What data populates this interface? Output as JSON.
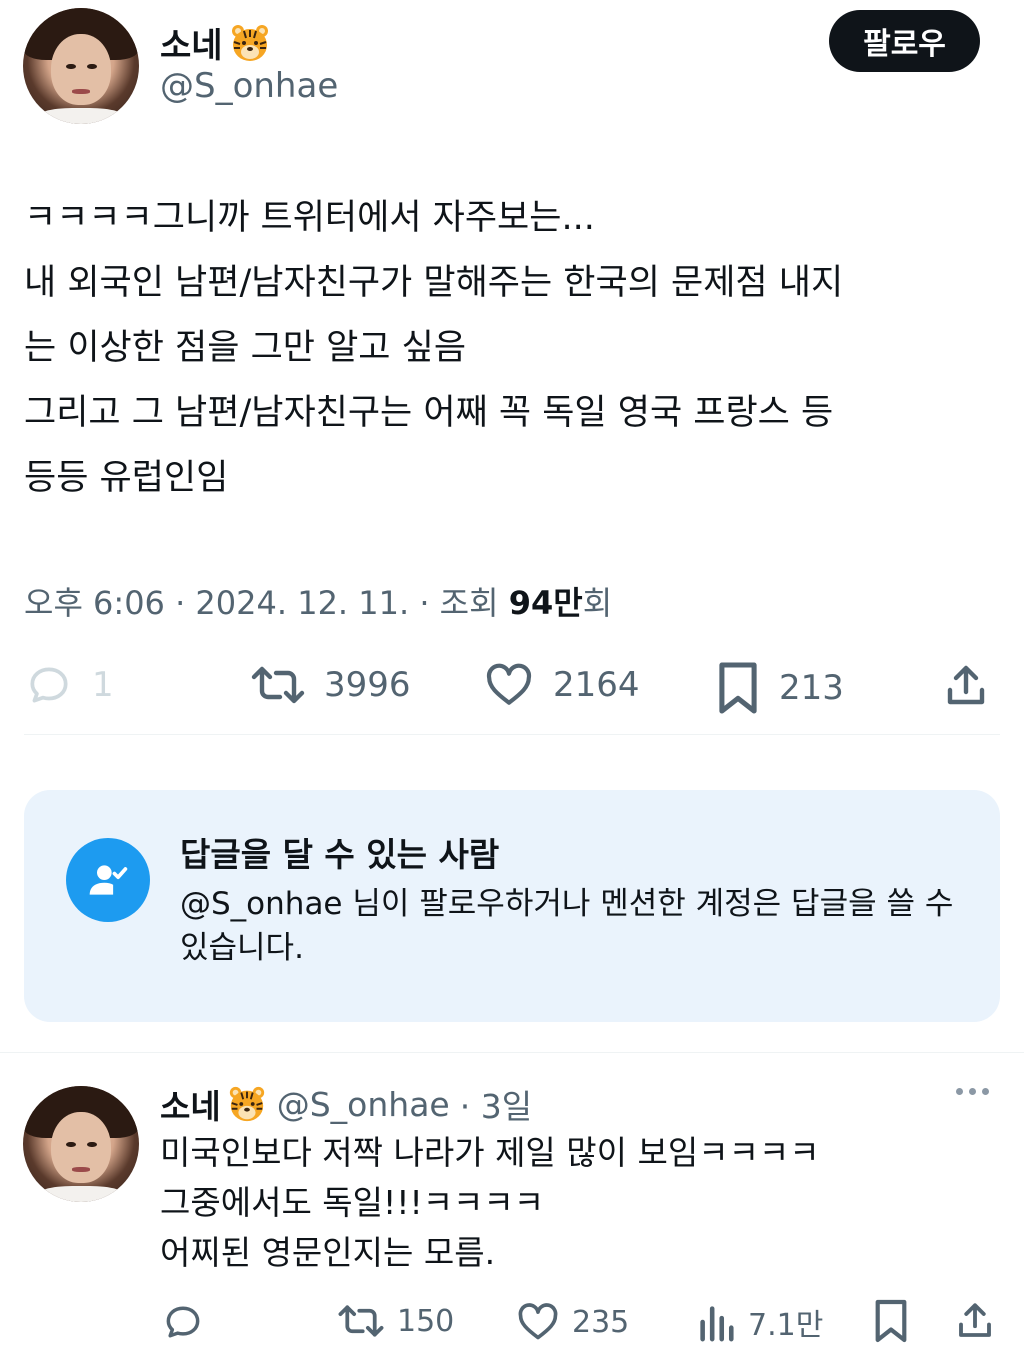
{
  "tweet": {
    "author_name": "소네",
    "author_emoji": "tiger-face-icon",
    "author_handle": "@S_onhae",
    "follow_label": "팔로우",
    "text": "ㅋㅋㅋㅋ그니까 트위터에서 자주보는...\n내 외국인 남편/남자친구가 말해주는 한국의 문제점 내지\n는 이상한 점을 그만 알고 싶음\n그리고 그 남편/남자친구는 어째 꼭 독일 영국 프랑스 등\n등등 유럽인임",
    "meta_prefix": "오후 6:06 · 2024. 12. 11. · 조회 ",
    "views_value": "94만",
    "views_suffix": "회",
    "stats": {
      "replies": "1",
      "retweets": "3996",
      "likes": "2164",
      "bookmarks": "213"
    }
  },
  "reply_restriction": {
    "title": "답글을 달 수 있는 사람",
    "description": "@S_onhae 님이 팔로우하거나 멘션한 계정은 답글을 쓸 수 있습니다."
  },
  "reply": {
    "author_name": "소네",
    "author_handle": "@S_onhae",
    "time": "· 3일",
    "text": "미국인보다 저짝 나라가 제일 많이 보임ㅋㅋㅋㅋ\n그중에서도 독일!!!ㅋㅋㅋㅋ\n어찌된 영문인지는 모름.",
    "stats": {
      "retweets": "150",
      "likes": "235",
      "views": "7.1만"
    }
  },
  "colors": {
    "primary_text": "#0f1419",
    "secondary_text": "#536471",
    "accent_blue": "#1d9bf0",
    "card_bg": "#eaf3fc"
  }
}
